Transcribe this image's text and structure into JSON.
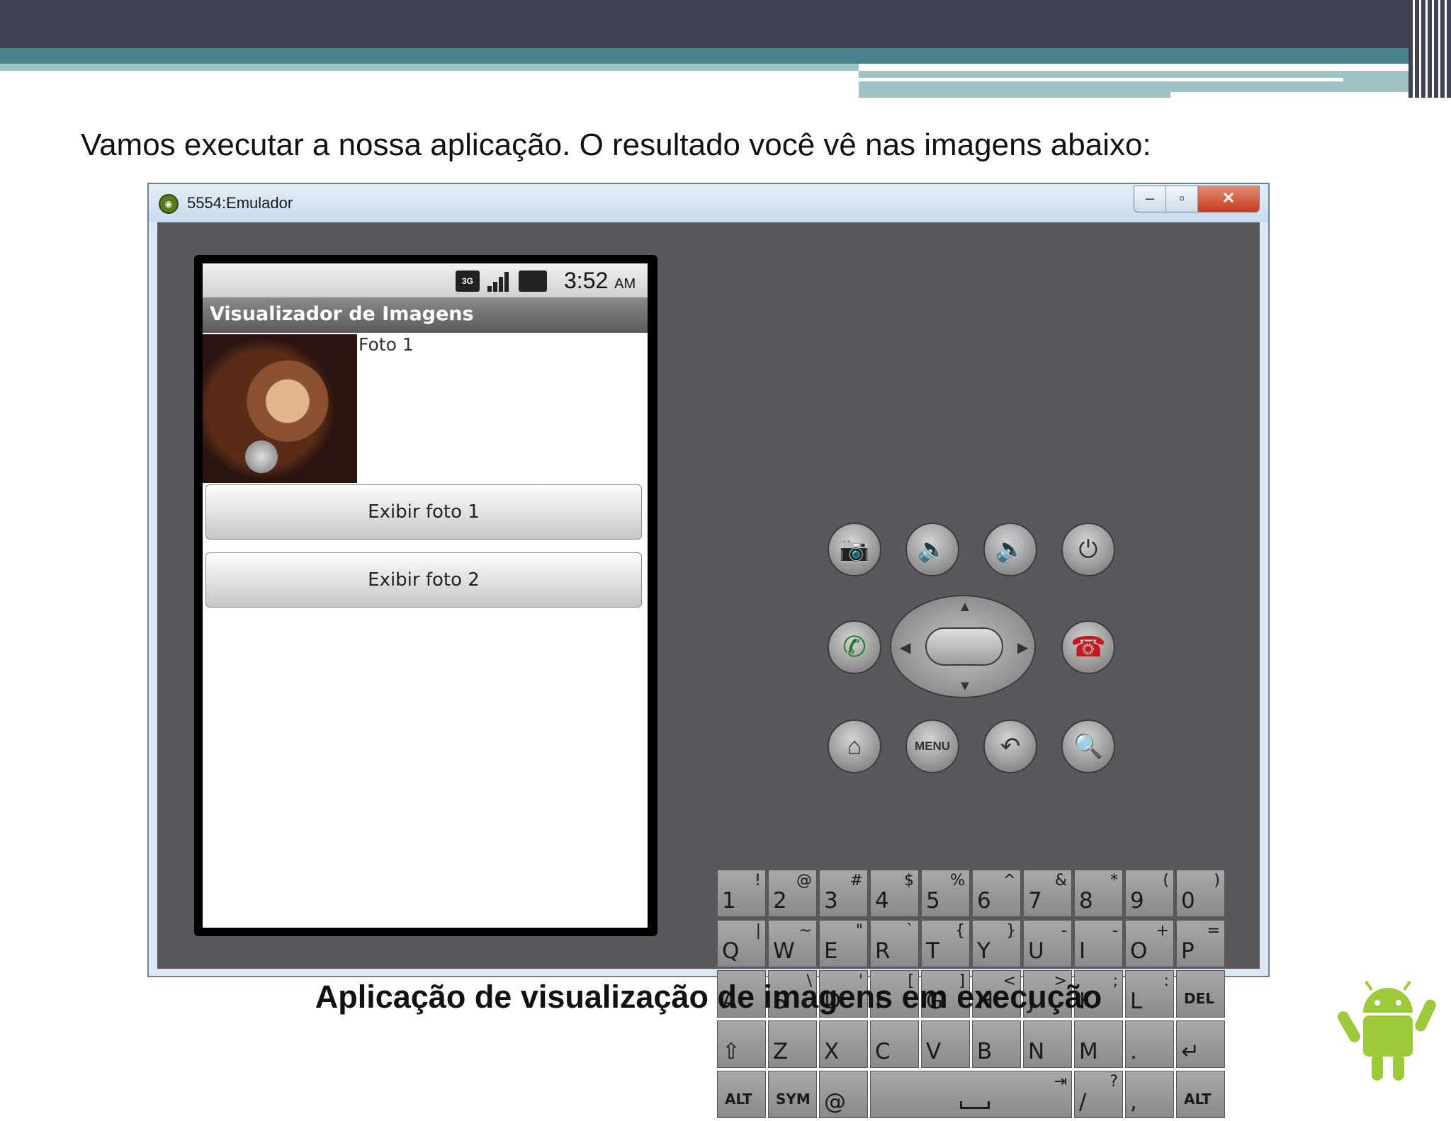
{
  "slide": {
    "text": "Vamos executar a nossa aplicação. O resultado você vê nas imagens abaixo:",
    "caption": "Aplicação de visualização de imagens em execução"
  },
  "window": {
    "title": "5554:Emulador",
    "minimize_icon": "minimize-icon",
    "maximize_icon": "maximize-icon",
    "close_icon": "close-icon"
  },
  "phone": {
    "status_time": "3:52",
    "status_ampm": "AM",
    "status_network": "3G",
    "app_title": "Visualizador de Imagens",
    "photo_label": "Foto 1",
    "buttons": [
      "Exibir foto 1",
      "Exibir foto 2"
    ]
  },
  "controls": {
    "camera": "camera-icon",
    "volume_down": "volume-down-icon",
    "volume_up": "volume-up-icon",
    "power": "power-icon",
    "call": "call-icon",
    "end_call": "end-call-icon",
    "home": "home-icon",
    "menu_label": "MENU",
    "back": "back-icon",
    "search": "search-icon"
  },
  "keyboard": {
    "rows": [
      [
        [
          "1",
          "!"
        ],
        [
          "2",
          "@"
        ],
        [
          "3",
          "#"
        ],
        [
          "4",
          "$"
        ],
        [
          "5",
          "%"
        ],
        [
          "6",
          "^"
        ],
        [
          "7",
          "&"
        ],
        [
          "8",
          "*"
        ],
        [
          "9",
          "("
        ],
        [
          "0",
          ")"
        ]
      ],
      [
        [
          "Q",
          "|"
        ],
        [
          "W",
          "~"
        ],
        [
          "E",
          "\""
        ],
        [
          "R",
          "`"
        ],
        [
          "T",
          "{"
        ],
        [
          "Y",
          "}"
        ],
        [
          "U",
          "-"
        ],
        [
          "I",
          "-"
        ],
        [
          "O",
          "+"
        ],
        [
          "P",
          "="
        ]
      ],
      [
        [
          "A",
          ""
        ],
        [
          "S",
          "\\"
        ],
        [
          "D",
          "'"
        ],
        [
          "F",
          "["
        ],
        [
          "G",
          "]"
        ],
        [
          "H",
          "<"
        ],
        [
          "J",
          ">"
        ],
        [
          "K",
          ";"
        ],
        [
          "L",
          ":"
        ],
        [
          "DEL",
          ""
        ]
      ],
      [
        [
          "⇧",
          ""
        ],
        [
          "Z",
          ""
        ],
        [
          "X",
          ""
        ],
        [
          "C",
          ""
        ],
        [
          "V",
          ""
        ],
        [
          "B",
          ""
        ],
        [
          "N",
          ""
        ],
        [
          "M",
          ""
        ],
        [
          ".",
          ""
        ],
        [
          "↵",
          ""
        ]
      ]
    ],
    "bottom": {
      "alt_left": "ALT",
      "sym": "SYM",
      "at": "@",
      "space_tab": "⇥",
      "slash": "/",
      "question": "?",
      "comma": ",",
      "alt_right": "ALT"
    }
  },
  "logo": "android-logo"
}
